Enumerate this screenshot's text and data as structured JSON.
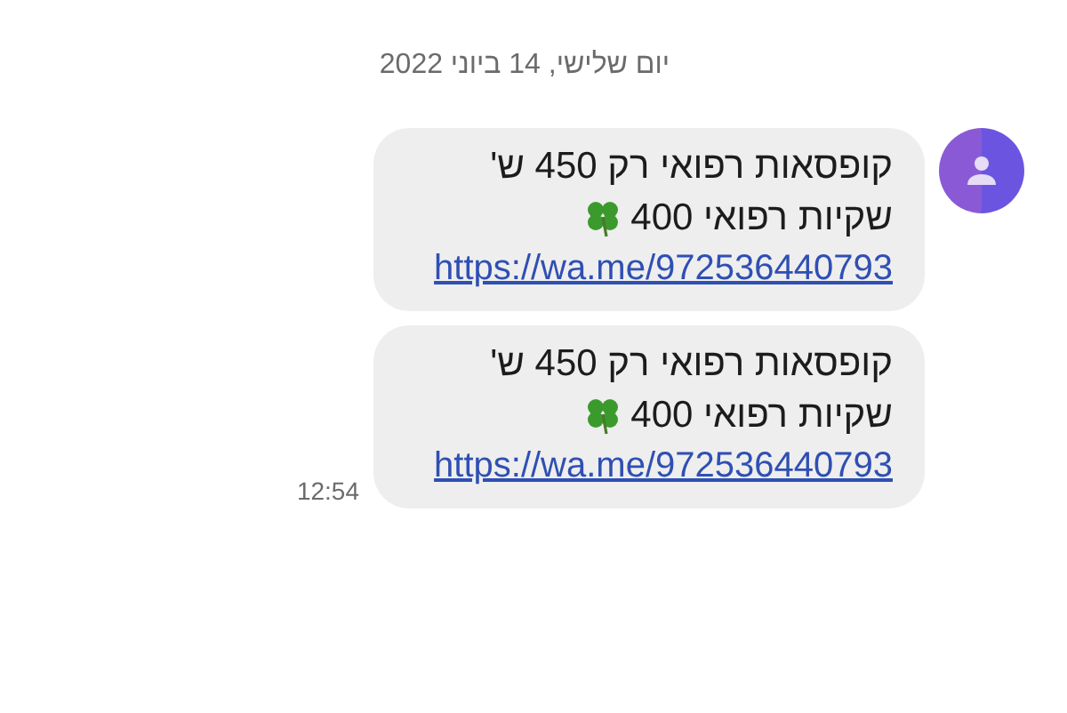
{
  "date_header": "יום שלישי, 14 ביוני 2022",
  "messages": [
    {
      "lines": [
        {
          "text": "קופסאות רפואי רק 450 ש'",
          "clover": false
        },
        {
          "text": "שקיות רפואי 400",
          "clover": true
        }
      ],
      "link": "https://wa.me/972536440793",
      "show_avatar": true
    },
    {
      "lines": [
        {
          "text": "קופסאות רפואי רק 450 ש'",
          "clover": false
        },
        {
          "text": "שקיות רפואי 400",
          "clover": true
        }
      ],
      "link": "https://wa.me/972536440793",
      "time": "12:54",
      "show_avatar": false
    }
  ]
}
